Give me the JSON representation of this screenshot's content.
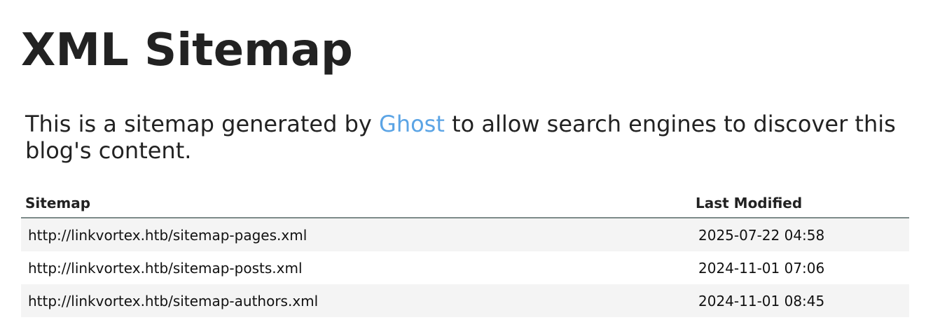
{
  "page": {
    "title": "XML Sitemap",
    "intro_before": "This is a sitemap generated by ",
    "intro_link": "Ghost",
    "intro_after": " to allow search engines to discover this blog's content."
  },
  "table": {
    "headers": [
      "Sitemap",
      "Last Modified"
    ],
    "rows": [
      {
        "url": "http://linkvortex.htb/sitemap-pages.xml",
        "modified": "2025-07-22 04:58"
      },
      {
        "url": "http://linkvortex.htb/sitemap-posts.xml",
        "modified": "2024-11-01 07:06"
      },
      {
        "url": "http://linkvortex.htb/sitemap-authors.xml",
        "modified": "2024-11-01 08:45"
      }
    ]
  },
  "colors": {
    "link": "#5ba4e5",
    "row_alt": "#f4f4f4",
    "header_rule": "#7d8b8a"
  }
}
